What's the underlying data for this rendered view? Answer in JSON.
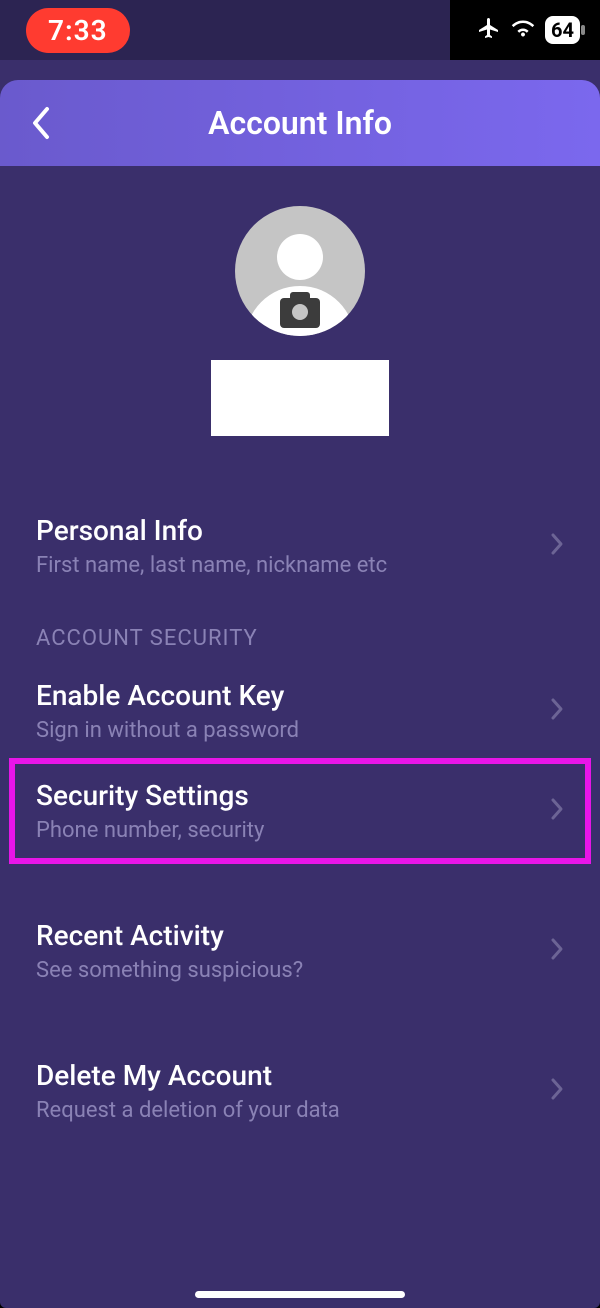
{
  "status": {
    "time": "7:33",
    "battery": "64"
  },
  "header": {
    "title": "Account Info"
  },
  "rows": {
    "personal": {
      "title": "Personal Info",
      "sub": "First name, last name, nickname etc"
    },
    "section_security": "ACCOUNT SECURITY",
    "enableKey": {
      "title": "Enable Account Key",
      "sub": "Sign in without a password"
    },
    "securitySettings": {
      "title": "Security Settings",
      "sub": "Phone number, security"
    },
    "recent": {
      "title": "Recent Activity",
      "sub": "See something suspicious?"
    },
    "deleteAcct": {
      "title": "Delete My Account",
      "sub": "Request a deletion of your data"
    }
  }
}
